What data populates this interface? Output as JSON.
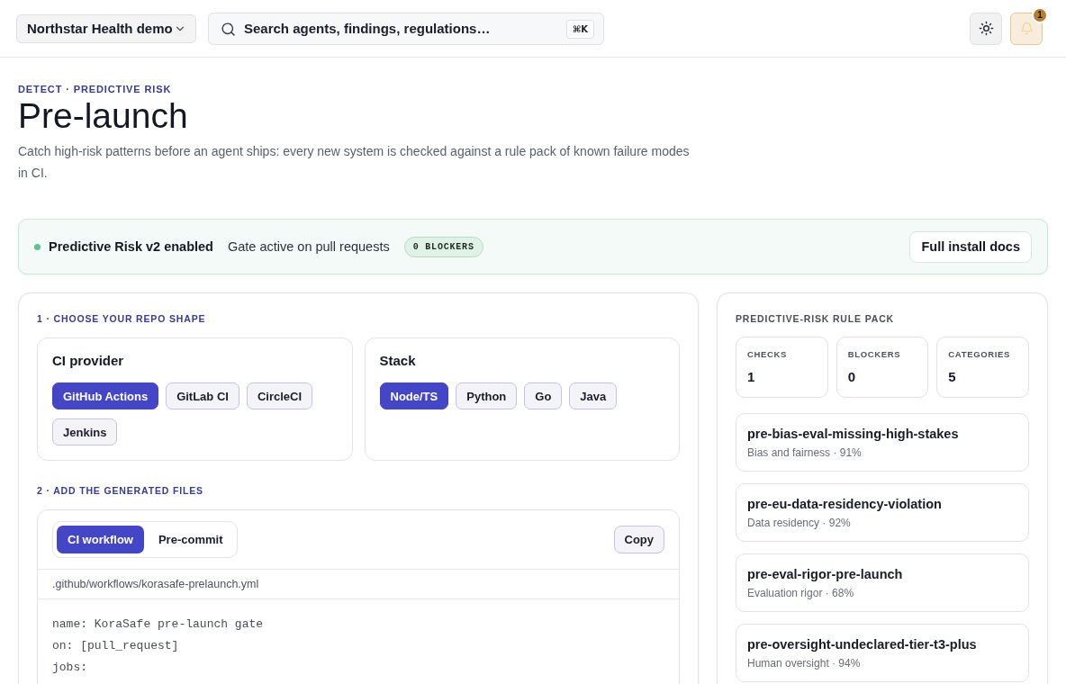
{
  "header": {
    "workspace": {
      "label": "Northstar Health demo"
    },
    "search": {
      "placeholder": "Search agents, findings, regulations…",
      "shortcut": "⌘K"
    },
    "notifications": {
      "count": "1"
    }
  },
  "page": {
    "eyebrow": "DETECT · PREDICTIVE RISK",
    "title": "Pre-launch",
    "description": "Catch high-risk patterns before an agent ships: every new system is checked against a rule pack of known failure modes in CI."
  },
  "status_banner": {
    "gate_enabled": true,
    "title": "Predictive Risk v2 enabled",
    "detail": "Gate active on pull requests",
    "badge": "0 BLOCKERS",
    "button": "Full install docs"
  },
  "setup": {
    "step_1": {
      "label": "1 · CHOOSE YOUR REPO SHAPE",
      "groups": [
        {
          "title": "CI provider",
          "options": [
            {
              "label": "GitHub Actions",
              "selected": true
            },
            {
              "label": "GitLab CI",
              "selected": false
            },
            {
              "label": "CircleCI",
              "selected": false
            },
            {
              "label": "Jenkins",
              "selected": false
            }
          ]
        },
        {
          "title": "Stack",
          "options": [
            {
              "label": "Node/TS",
              "selected": true
            },
            {
              "label": "Python",
              "selected": false
            },
            {
              "label": "Go",
              "selected": false
            },
            {
              "label": "Java",
              "selected": false
            }
          ]
        }
      ]
    },
    "step_2": {
      "label": "2 · ADD THE GENERATED FILES",
      "tabs": [
        {
          "label": "CI workflow",
          "selected": true
        },
        {
          "label": "Pre-commit",
          "selected": false
        }
      ],
      "copy_button": "Copy",
      "file_path": ".github/workflows/korasafe-prelaunch.yml",
      "code_lines": [
        "name: KoraSafe pre-launch gate",
        "on: [pull_request]",
        "jobs:"
      ]
    }
  },
  "rule_pack": {
    "title": "PREDICTIVE-RISK RULE PACK",
    "stats": [
      {
        "label": "CHECKS",
        "value": "1"
      },
      {
        "label": "BLOCKERS",
        "value": "0"
      },
      {
        "label": "CATEGORIES",
        "value": "5"
      }
    ],
    "rules": [
      {
        "name": "pre-bias-eval-missing-high-stakes",
        "meta": "Bias and fairness · 91%"
      },
      {
        "name": "pre-eu-data-residency-violation",
        "meta": "Data residency · 92%"
      },
      {
        "name": "pre-eval-rigor-pre-launch",
        "meta": "Evaluation rigor · 68%"
      },
      {
        "name": "pre-oversight-undeclared-tier-t3-plus",
        "meta": "Human oversight · 94%"
      }
    ]
  }
}
